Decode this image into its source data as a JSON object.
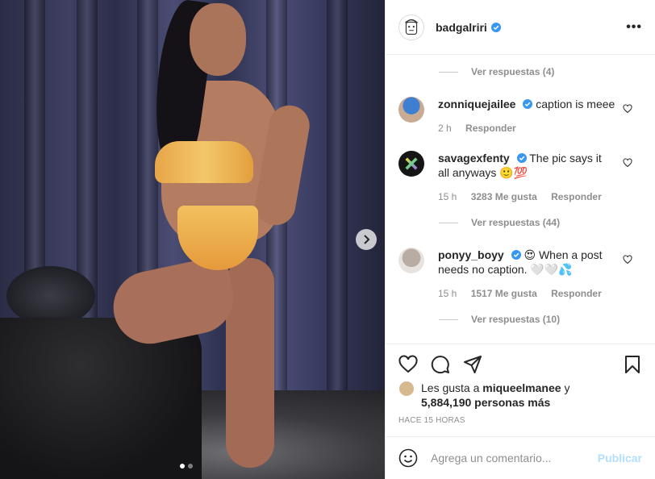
{
  "post": {
    "username": "badgalriri",
    "more_label": "•••"
  },
  "comments_panel": {
    "replies_top": "Ver respuestas (4)",
    "comments": [
      {
        "user": "zonniquejailee",
        "text": "caption is meee",
        "time": "2 h",
        "likes": "",
        "reply": "Responder",
        "avatar_color": "#7fa7c9"
      },
      {
        "user": "savagexfenty",
        "text": "The pic says it all anyways 🙂💯",
        "time": "15 h",
        "likes": "3283 Me gusta",
        "reply": "Responder",
        "avatar_color": "#1c1c1c",
        "replies": "Ver respuestas (44)"
      },
      {
        "user": "ponyy_boyy",
        "text": "😍 When a post needs no caption. 🤍🤍💦",
        "time": "15 h",
        "likes": "1517 Me gusta",
        "reply": "Responder",
        "avatar_color": "#9a8f86",
        "replies": "Ver respuestas (10)"
      }
    ]
  },
  "likes": {
    "prefix": "Les gusta a",
    "user": "miqueelmanee",
    "connector": "y",
    "count": "5,884,190 personas más"
  },
  "timestamp": "HACE 15 HORAS",
  "add_comment": {
    "placeholder": "Agrega un comentario...",
    "publish_label": "Publicar"
  },
  "colors": {
    "verified": "#3897f0",
    "publish_disabled": "#b2dffc",
    "muted": "#8e8e8e"
  },
  "carousel": {
    "total": 2,
    "active": 1
  }
}
